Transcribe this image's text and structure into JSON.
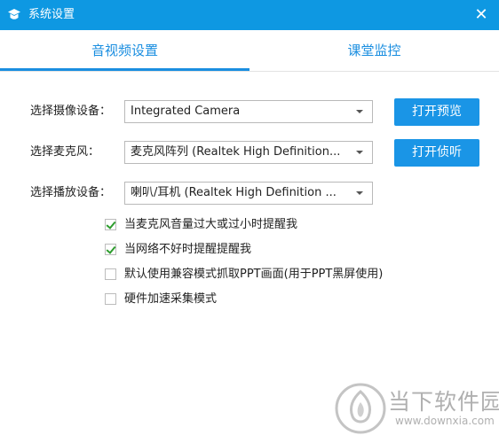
{
  "window": {
    "title": "系统设置",
    "close_glyph": "✕",
    "logo_icon": "app-logo-icon",
    "accent_color": "#0e98e2"
  },
  "tabs": [
    {
      "label": "音视频设置",
      "active": true
    },
    {
      "label": "课堂监控",
      "active": false
    }
  ],
  "devices": {
    "camera": {
      "label": "选择摄像设备：",
      "value": "Integrated Camera",
      "button": "打开预览"
    },
    "microphone": {
      "label": "选择麦克风：",
      "value": "麦克风阵列 (Realtek High Definition...",
      "button": "打开侦听"
    },
    "speaker": {
      "label": "选择播放设备：",
      "value": "喇叭/耳机 (Realtek High Definition ..."
    }
  },
  "options": [
    {
      "label": "当麦克风音量过大或过小时提醒我",
      "checked": true
    },
    {
      "label": "当网络不好时提醒提醒我",
      "checked": true
    },
    {
      "label": "默认使用兼容模式抓取PPT画面(用于PPT黑屏使用)",
      "checked": false
    },
    {
      "label": "硬件加速采集模式",
      "checked": false
    }
  ],
  "watermark": {
    "brand": "当下软件园",
    "url": "www.downxia.com"
  }
}
